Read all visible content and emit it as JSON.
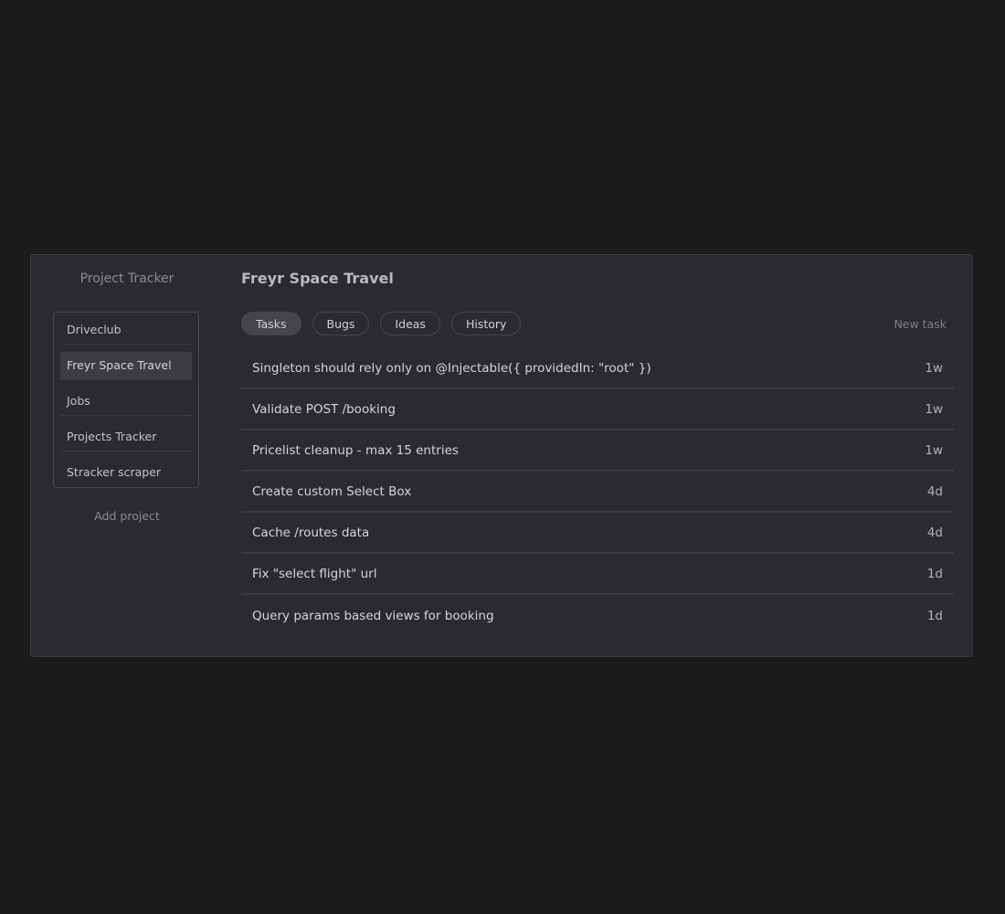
{
  "sidebar": {
    "brand": "Project Tracker",
    "projects": [
      {
        "label": "Driveclub",
        "active": false
      },
      {
        "label": "Freyr Space Travel",
        "active": true
      },
      {
        "label": "Jobs",
        "active": false
      },
      {
        "label": "Projects Tracker",
        "active": false
      },
      {
        "label": "Stracker scraper",
        "active": false
      }
    ],
    "add_project_label": "Add project"
  },
  "main": {
    "title": "Freyr Space Travel",
    "tabs": [
      {
        "label": "Tasks",
        "active": true
      },
      {
        "label": "Bugs",
        "active": false
      },
      {
        "label": "Ideas",
        "active": false
      },
      {
        "label": "History",
        "active": false
      }
    ],
    "new_task_label": "New task",
    "tasks": [
      {
        "title": "Singleton should rely only on @Injectable({ providedIn: \"root\" })",
        "age": "1w"
      },
      {
        "title": "Validate POST /booking",
        "age": "1w"
      },
      {
        "title": "Pricelist cleanup - max 15 entries",
        "age": "1w"
      },
      {
        "title": "Create custom Select Box",
        "age": "4d"
      },
      {
        "title": "Cache /routes data",
        "age": "4d"
      },
      {
        "title": "Fix \"select flight\" url",
        "age": "1d"
      },
      {
        "title": "Query params based views for booking",
        "age": "1d"
      }
    ]
  },
  "colors": {
    "page_background": "#1b1b1b",
    "panel_background": "#2a2b30",
    "active_item": "#3c3d42",
    "active_tab": "#45464b"
  }
}
